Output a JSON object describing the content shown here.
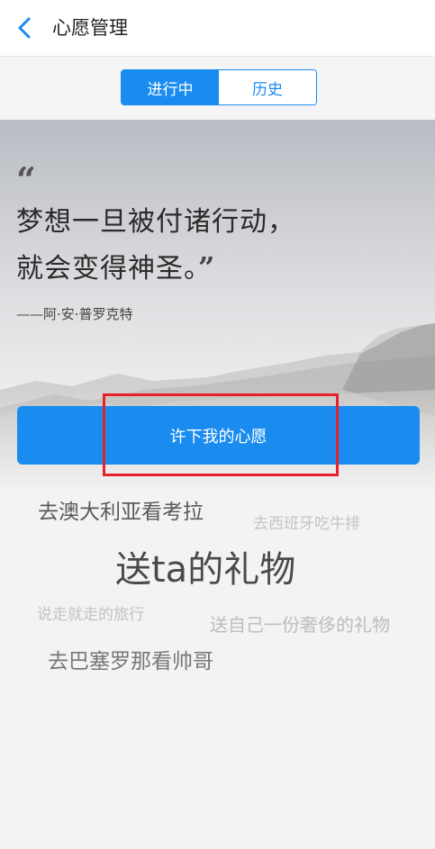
{
  "header": {
    "title": "心愿管理",
    "back_icon": "chevron-left-icon"
  },
  "tabs": [
    {
      "label": "进行中",
      "active": true
    },
    {
      "label": "历史",
      "active": false
    }
  ],
  "quote": {
    "open_mark": "“",
    "line1": "梦想一旦被付诸行动，",
    "line2": "就会变得神圣。",
    "close_mark": "”",
    "author": "——阿·安·普罗克特"
  },
  "wish_button": {
    "label": "许下我的心愿"
  },
  "wish_tags": [
    "去澳大利亚看考拉",
    "去西班牙吃牛排",
    "送ta的礼物",
    "说走就走的旅行",
    "送自己一份奢侈的礼物",
    "去巴塞罗那看帅哥"
  ],
  "colors": {
    "accent": "#1a8cf0",
    "highlight": "#e8202a"
  }
}
